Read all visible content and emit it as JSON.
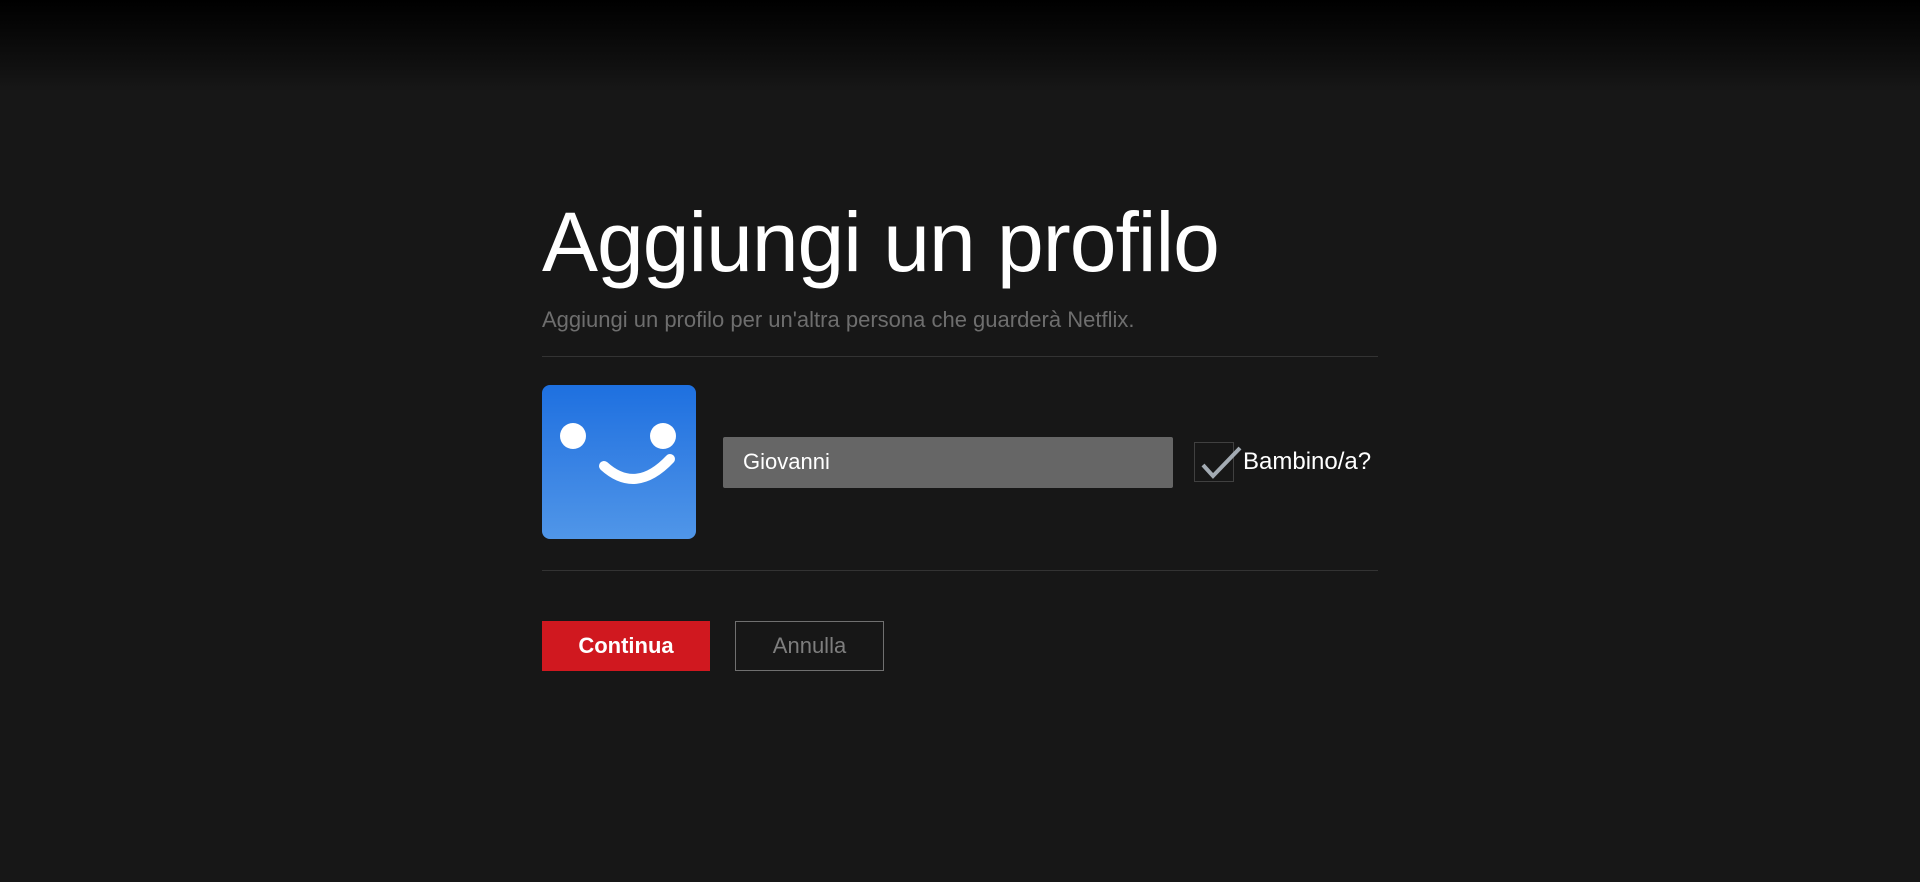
{
  "page": {
    "title": "Aggiungi un profilo",
    "subtitle": "Aggiungi un profilo per un'altra persona che guarderà Netflix."
  },
  "profile": {
    "name_value": "Giovanni",
    "kids_label": "Bambino/a?",
    "kids_checked": true,
    "avatar_icon": "smiley-profile-avatar"
  },
  "actions": {
    "continue_label": "Continua",
    "cancel_label": "Annulla"
  },
  "colors": {
    "background": "#171717",
    "accent_red": "#d0181f",
    "avatar_gradient_top": "#1e70e0",
    "avatar_gradient_bottom": "#5096e8",
    "input_background": "#666666",
    "subtitle_gray": "#6e6e6e",
    "divider_gray": "#333333",
    "checkmark_gray": "#a3abb3"
  }
}
